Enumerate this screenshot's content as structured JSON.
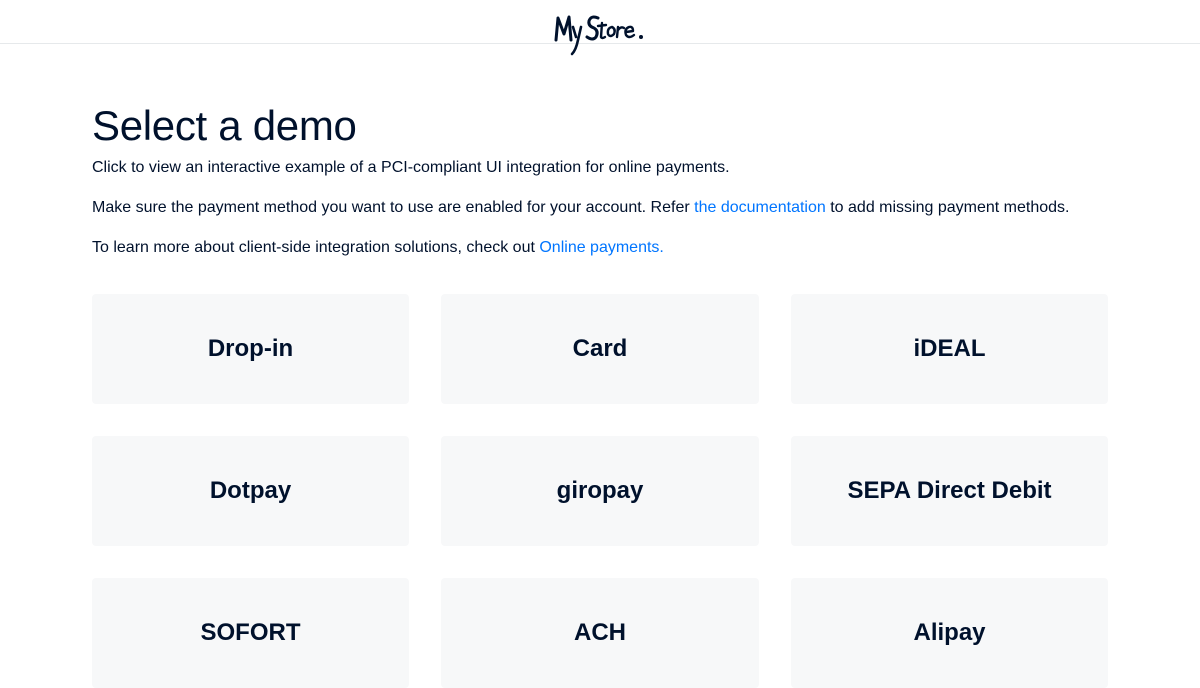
{
  "header": {
    "logo_text": "MyStore."
  },
  "main": {
    "title": "Select a demo",
    "intro": "Click to view an interactive example of a PCI-compliant UI integration for online payments.",
    "enable_text_before": "Make sure the payment method you want to use are enabled for your account. Refer ",
    "enable_link": "the documentation",
    "enable_text_after": " to add missing payment methods.",
    "learn_text_before": "To learn more about client-side integration solutions, check out ",
    "learn_link": "Online payments."
  },
  "demos": [
    {
      "label": "Drop-in"
    },
    {
      "label": "Card"
    },
    {
      "label": "iDEAL"
    },
    {
      "label": "Dotpay"
    },
    {
      "label": "giropay"
    },
    {
      "label": "SEPA Direct Debit"
    },
    {
      "label": "SOFORT"
    },
    {
      "label": "ACH"
    },
    {
      "label": "Alipay"
    }
  ],
  "colors": {
    "text": "#00112c",
    "link": "#0075ff",
    "card_bg": "#f7f8f9",
    "divider": "#e6e9eb"
  }
}
